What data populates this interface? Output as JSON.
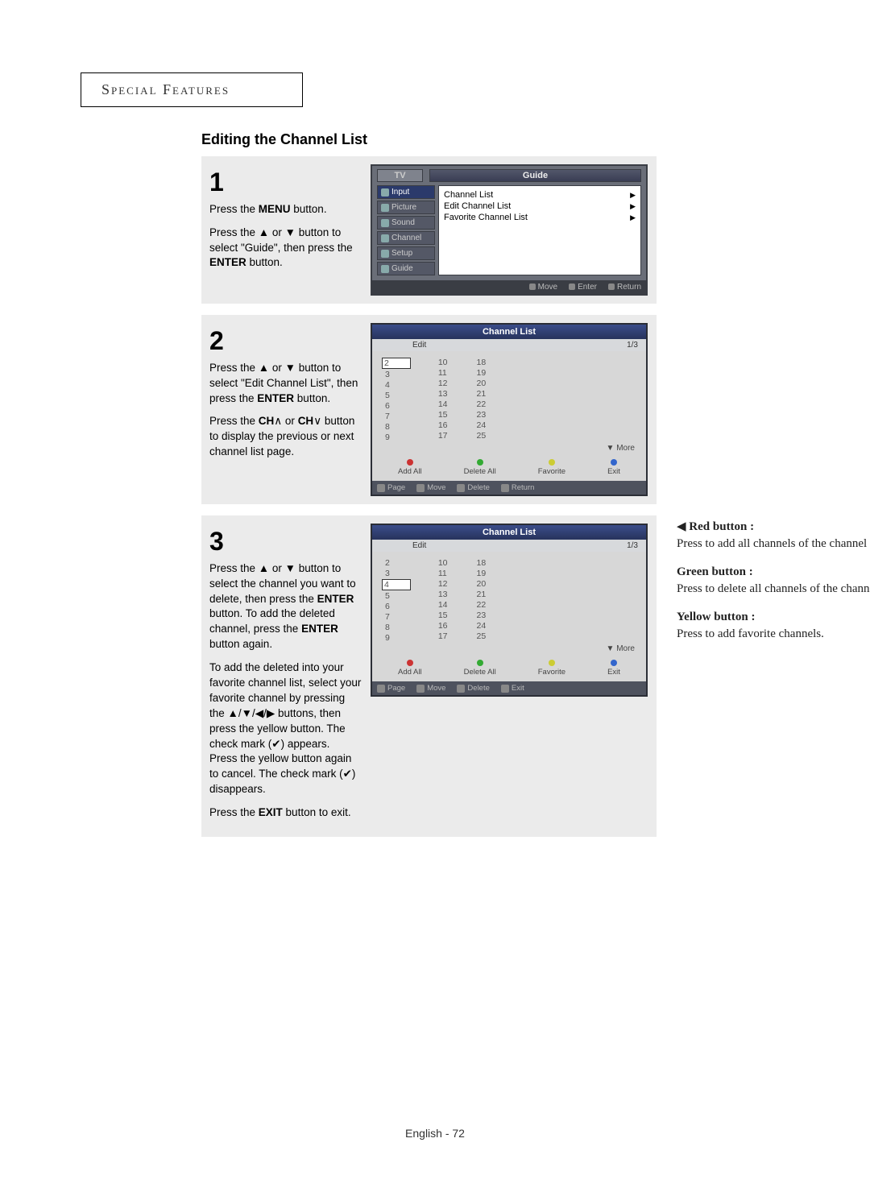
{
  "section_tab": "Special Features",
  "heading": "Editing the Channel List",
  "steps": {
    "s1": {
      "num": "1",
      "p1_a": "Press the ",
      "p1_b": "MENU",
      "p1_c": " button.",
      "p2": "Press the ▲ or ▼ button to select \"Guide\", then press the ",
      "p2_b": "ENTER",
      "p2_c": " button."
    },
    "s2": {
      "num": "2",
      "p1": "Press the ▲ or ▼ button to select \"Edit Channel List\", then press the ",
      "p1_b": "ENTER",
      "p1_c": " button.",
      "p2_a": "Press the ",
      "p2_b": "CH",
      "p2_c": " or ",
      "p2_d": "CH",
      "p2_e": " button to display the previous or next channel list page."
    },
    "s3": {
      "num": "3",
      "p1": "Press the ▲ or ▼ button to select the channel you want to delete, then press the ",
      "p1_b": "ENTER",
      "p1_c": " button. To add the deleted channel, press the ",
      "p1_d": "ENTER",
      "p1_e": " button again.",
      "p2": "To add the deleted into your favorite channel list, select your favorite channel by pressing the ▲/▼/◀/▶ buttons, then press the yellow button. The check mark (✔) appears.",
      "p2b": "Press the yellow button again to cancel. The check mark (✔) disappears.",
      "p3_a": "Press the ",
      "p3_b": "EXIT",
      "p3_c": " button to exit."
    }
  },
  "osd1": {
    "tv": "TV",
    "title": "Guide",
    "side": [
      "Input",
      "Picture",
      "Sound",
      "Channel",
      "Setup",
      "Guide"
    ],
    "panel": [
      "Channel List",
      "Edit Channel List",
      "Favorite Channel List"
    ],
    "footer": [
      "Move",
      "Enter",
      "Return"
    ]
  },
  "osd2": {
    "title": "Channel List",
    "tab": "Edit",
    "page": "1/3",
    "cols": [
      [
        "2",
        "3",
        "4",
        "5",
        "6",
        "7",
        "8",
        "9"
      ],
      [
        "10",
        "11",
        "12",
        "13",
        "14",
        "15",
        "16",
        "17"
      ],
      [
        "18",
        "19",
        "20",
        "21",
        "22",
        "23",
        "24",
        "25"
      ]
    ],
    "sel_a": "2",
    "sel_b": "4",
    "more": "▼ More",
    "btns": [
      "Add All",
      "Delete All",
      "Favorite",
      "Exit"
    ],
    "footer": [
      "Page",
      "Move",
      "Delete",
      "Return"
    ],
    "footer_b": [
      "Page",
      "Move",
      "Delete",
      "Exit"
    ]
  },
  "notes": {
    "red_t": "Red button :",
    "red_b": "Press to add all channels of the channel list.",
    "green_t": "Green button :",
    "green_b": "Press to delete all channels of the channel list.",
    "yellow_t": "Yellow button :",
    "yellow_b": "Press to add favorite channels."
  },
  "page_footer": "English - 72"
}
